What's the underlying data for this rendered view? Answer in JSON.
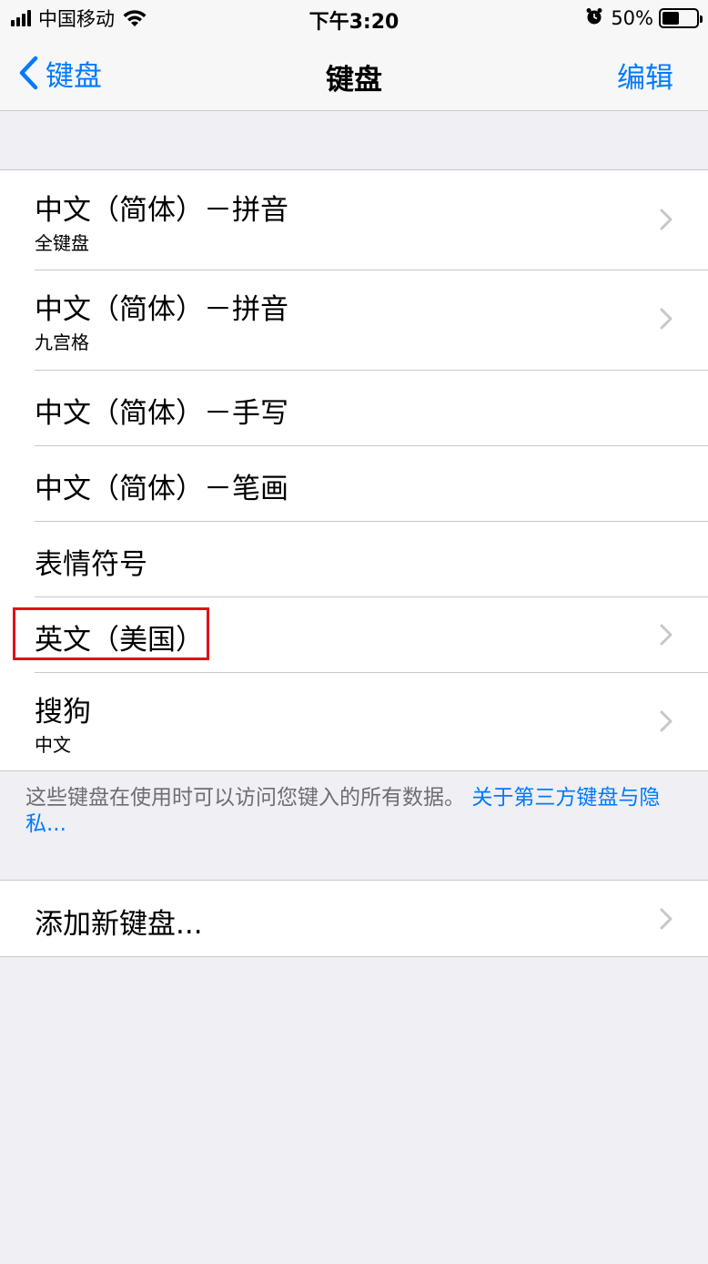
{
  "status_bar": {
    "carrier": "中国移动",
    "time": "下午3:20",
    "battery_percent": "50%",
    "battery_level": 0.5
  },
  "nav": {
    "back_label": "键盘",
    "title": "键盘",
    "edit_label": "编辑"
  },
  "keyboards": [
    {
      "title": "中文（简体）－拼音",
      "subtitle": "全键盘",
      "has_chevron": true
    },
    {
      "title": "中文（简体）－拼音",
      "subtitle": "九宫格",
      "has_chevron": true
    },
    {
      "title": "中文（简体）－手写",
      "subtitle": "",
      "has_chevron": false
    },
    {
      "title": "中文（简体）－笔画",
      "subtitle": "",
      "has_chevron": false
    },
    {
      "title": "表情符号",
      "subtitle": "",
      "has_chevron": false
    },
    {
      "title": "英文（美国）",
      "subtitle": "",
      "has_chevron": true
    },
    {
      "title": "搜狗",
      "subtitle": "中文",
      "has_chevron": true
    }
  ],
  "footer": {
    "text": "这些键盘在使用时可以访问您键入的所有数据。",
    "link": "关于第三方键盘与隐私..."
  },
  "add_keyboard": {
    "label": "添加新键盘..."
  },
  "colors": {
    "accent": "#007aff",
    "background": "#efeff4",
    "highlight": "#e0111b"
  }
}
